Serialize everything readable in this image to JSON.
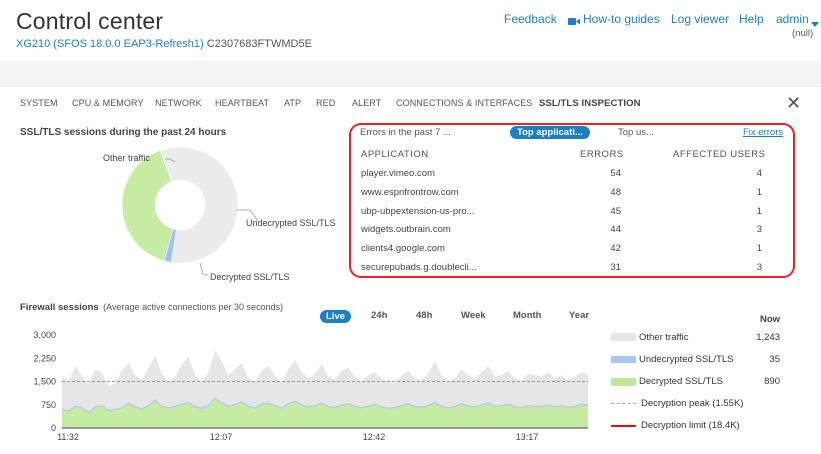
{
  "header": {
    "title": "Control center",
    "device_link": "XG210 (SFOS 18.0.0 EAP3-Refresh1)",
    "serial": "C2307683FTWMD5E",
    "nav": {
      "feedback": "Feedback",
      "howto": "How-to guides",
      "logviewer": "Log viewer",
      "help": "Help",
      "admin": "admin",
      "admin_sub": "(null)"
    }
  },
  "tabs": [
    "SYSTEM",
    "CPU & MEMORY",
    "NETWORK",
    "HEARTBEAT",
    "ATP",
    "RED",
    "ALERT",
    "CONNECTIONS & INTERFACES",
    "SSL/TLS INSPECTION"
  ],
  "active_tab": "SSL/TLS INSPECTION",
  "sessions_panel": {
    "title": "SSL/TLS sessions during the past 24 hours",
    "labels": {
      "other": "Other traffic",
      "undecrypted": "Undecrypted SSL/TLS",
      "decrypted": "Decrypted SSL/TLS"
    }
  },
  "errors_panel": {
    "tabs": [
      "Errors in the past 7 ...",
      "Top applicati...",
      "Top us..."
    ],
    "active_tab": "Top applicati...",
    "fix_link": "Fix errors",
    "columns": [
      "APPLICATION",
      "ERRORS",
      "AFFECTED USERS"
    ],
    "rows": [
      {
        "app": "player.vimeo.com",
        "errors": "54",
        "users": "4"
      },
      {
        "app": "www.espnfrontrow.com",
        "errors": "48",
        "users": "1"
      },
      {
        "app": "ubp-ubpextension-us-pro...",
        "errors": "45",
        "users": "1"
      },
      {
        "app": "widgets.outbrain.com",
        "errors": "44",
        "users": "3"
      },
      {
        "app": "clients4.google.com",
        "errors": "42",
        "users": "1"
      },
      {
        "app": "securepubads.g.doublecli...",
        "errors": "31",
        "users": "3"
      }
    ]
  },
  "firewall_panel": {
    "title": "Firewall sessions",
    "subtitle": "(Average active connections per 30 seconds)",
    "ranges": [
      "Live",
      "24h",
      "48h",
      "Week",
      "Month",
      "Year"
    ],
    "active_range": "Live",
    "now_label": "Now",
    "legend": [
      {
        "name": "Other traffic",
        "value": "1,243",
        "color": "#e6e6e6"
      },
      {
        "name": "Undecrypted SSL/TLS",
        "value": "35",
        "color": "#a9c8ef"
      },
      {
        "name": "Decrypted SSL/TLS",
        "value": "890",
        "color": "#bfe89a"
      },
      {
        "name": "Decryption peak (1.55K)",
        "value": "",
        "color": "#aaaaaa"
      },
      {
        "name": "Decryption limit (18.4K)",
        "value": "",
        "color": "#dd1111"
      }
    ]
  },
  "chart_data": [
    {
      "type": "pie",
      "categories": [
        "Other traffic",
        "Undecrypted SSL/TLS",
        "Decrypted SSL/TLS"
      ],
      "values": [
        58,
        2,
        40
      ],
      "colors": [
        "#ececec",
        "#9fc3ee",
        "#c5eca2"
      ]
    },
    {
      "type": "area",
      "xticks": [
        "11:32",
        "12:07",
        "12:42",
        "13:17"
      ],
      "yticks": [
        "0",
        "750",
        "1,500",
        "2,250",
        "3,000"
      ],
      "ylim": [
        0,
        3000
      ],
      "reference_line": 1500,
      "series": [
        {
          "name": "Other traffic",
          "values": [
            1700,
            1500,
            2000,
            1650,
            1400,
            1900,
            1800,
            1350,
            1450,
            1850,
            2100,
            1700,
            1550,
            1950,
            2350,
            1750,
            1500,
            1650,
            2050,
            2300,
            1700,
            1500,
            1800,
            2500,
            2150,
            1700,
            1900,
            2100,
            1600,
            1500,
            1850,
            2000,
            1700,
            1450,
            1900,
            2200,
            1800,
            1600,
            1750,
            2050,
            1650,
            1550,
            1850,
            1950,
            1650,
            1500,
            1700,
            1800,
            1600,
            1500,
            1450,
            1700,
            1850,
            1600,
            1550,
            1750,
            2150,
            1700,
            1500,
            1600,
            1900,
            1700,
            1600,
            1800,
            2000,
            1650,
            1700,
            1850,
            1600,
            1500,
            1750,
            1700,
            1650,
            1800,
            1600,
            1700,
            1550,
            1650,
            1800,
            1750
          ]
        },
        {
          "name": "Decrypted SSL/TLS",
          "values": [
            600,
            550,
            700,
            650,
            500,
            680,
            720,
            560,
            600,
            650,
            800,
            680,
            620,
            720,
            900,
            700,
            650,
            700,
            760,
            820,
            680,
            640,
            720,
            950,
            820,
            700,
            760,
            850,
            700,
            640,
            780,
            800,
            720,
            640,
            780,
            860,
            740,
            680,
            720,
            800,
            690,
            660,
            740,
            780,
            700,
            650,
            700,
            760,
            680,
            640,
            660,
            720,
            780,
            690,
            670,
            720,
            820,
            700,
            650,
            690,
            780,
            720,
            680,
            740,
            820,
            700,
            720,
            760,
            690,
            660,
            720,
            700,
            690,
            740,
            680,
            720,
            660,
            700,
            760,
            740
          ]
        }
      ]
    }
  ]
}
